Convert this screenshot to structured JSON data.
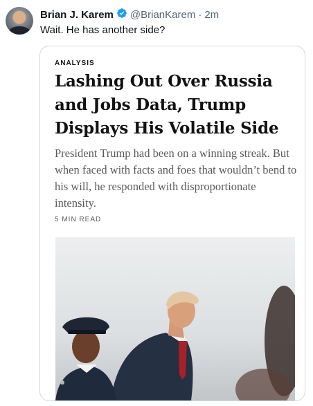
{
  "tweet": {
    "author_name": "Brian J. Karem",
    "handle": "@BrianKarem",
    "separator": "·",
    "time": "2m",
    "text": "Wait. He has another side?"
  },
  "card": {
    "kicker": "ANALYSIS",
    "headline": "Lashing Out Over Russia and Jobs Data, Trump Displays His Volatile Side",
    "summary": "President Trump had been on a winning streak. But when faced with facts and foes that wouldn’t bend to his will, he responded with disproportionate intensity.",
    "read_time": "5 MIN READ"
  },
  "icons": {
    "verified": "verified-badge-icon"
  },
  "colors": {
    "verified_blue": "#1d9bf0",
    "muted": "#536471",
    "border": "#cfd9de"
  }
}
